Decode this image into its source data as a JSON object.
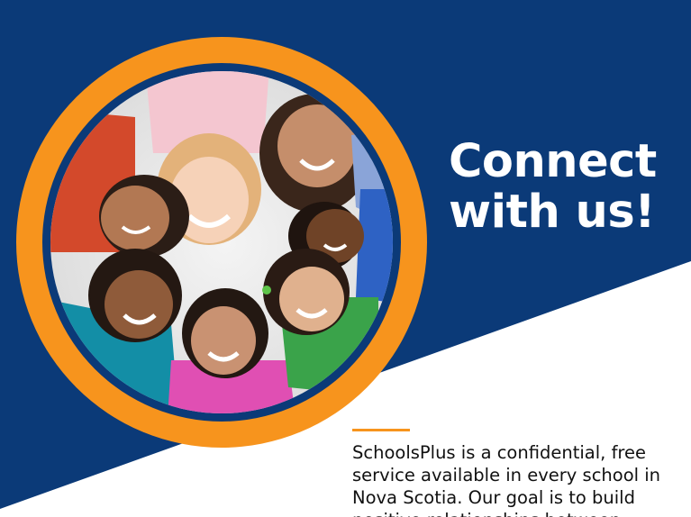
{
  "headline": {
    "line1": "Connect",
    "line2": "with us!"
  },
  "body": {
    "line1": "SchoolsPlus is a confidential, free",
    "line2": "service available in every school in",
    "line3": "Nova Scotia. Our goal is to build",
    "line4": "positive relationships between"
  },
  "colors": {
    "navy": "#0B3A78",
    "orange": "#F7941D",
    "white": "#FFFFFF",
    "text": "#111111"
  },
  "photo": {
    "subject": "group-of-smiling-children-lying-in-circle"
  }
}
